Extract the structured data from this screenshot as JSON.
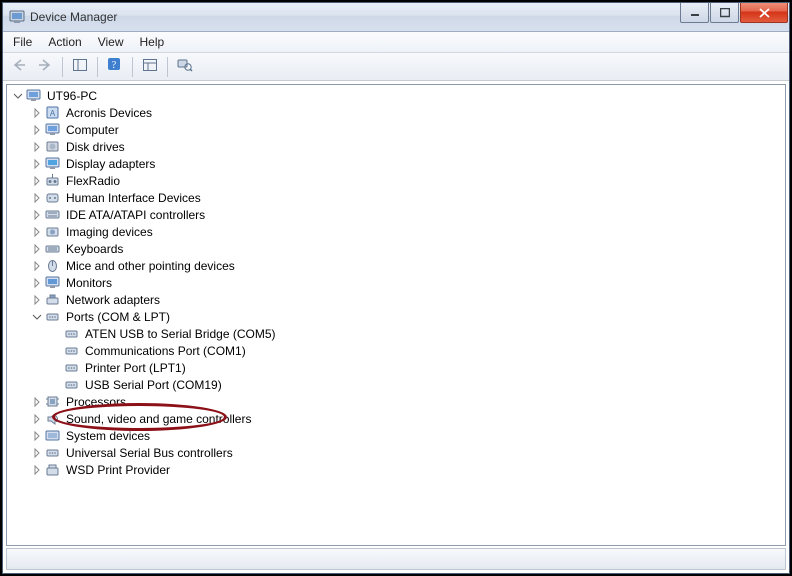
{
  "window": {
    "title": "Device Manager"
  },
  "menu": {
    "file": "File",
    "action": "Action",
    "view": "View",
    "help": "Help"
  },
  "tree": {
    "root": "UT96-PC",
    "items": [
      {
        "label": "Acronis Devices"
      },
      {
        "label": "Computer"
      },
      {
        "label": "Disk drives"
      },
      {
        "label": "Display adapters"
      },
      {
        "label": "FlexRadio"
      },
      {
        "label": "Human Interface Devices"
      },
      {
        "label": "IDE ATA/ATAPI controllers"
      },
      {
        "label": "Imaging devices"
      },
      {
        "label": "Keyboards"
      },
      {
        "label": "Mice and other pointing devices"
      },
      {
        "label": "Monitors"
      },
      {
        "label": "Network adapters"
      },
      {
        "label": "Ports (COM & LPT)",
        "children": [
          {
            "label": "ATEN USB to Serial Bridge (COM5)"
          },
          {
            "label": "Communications Port (COM1)"
          },
          {
            "label": "Printer Port (LPT1)"
          },
          {
            "label": "USB Serial Port (COM19)"
          }
        ]
      },
      {
        "label": "Processors"
      },
      {
        "label": "Sound, video and game controllers"
      },
      {
        "label": "System devices"
      },
      {
        "label": "Universal Serial Bus controllers"
      },
      {
        "label": "WSD Print Provider"
      }
    ]
  }
}
